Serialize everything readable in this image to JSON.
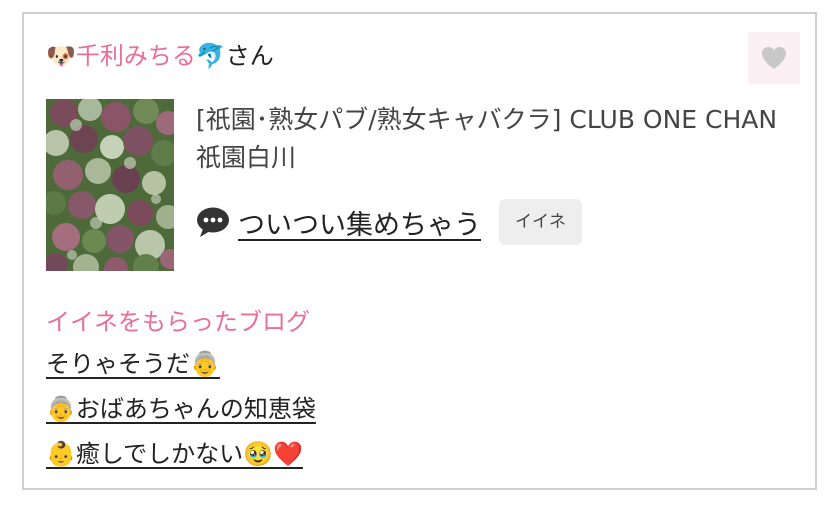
{
  "header": {
    "emoji_left": "🐶",
    "user_name": "千利みちる",
    "emoji_right": "🐬",
    "honorific": "さん"
  },
  "like_button": {
    "icon": "heart-icon",
    "color": "#c8c8c8"
  },
  "shop": {
    "category_name": "[祇園･熟女パブ/熟女キャバクラ]  CLUB ONE CHAN",
    "area": "祇園白川"
  },
  "post": {
    "icon": "speech-bubble-icon",
    "title": "ついつい集めちゃう",
    "iine_label": "イイネ"
  },
  "liked_blogs": {
    "heading": "イイネをもらったブログ",
    "items": [
      "そりゃそうだ👵",
      "👵おばあちゃんの知恵袋",
      "👶癒しでしかない🥹❤️"
    ]
  },
  "colors": {
    "accent_pink": "#e86f98",
    "card_border": "#cfcfcf",
    "badge_bg": "#eeeeee"
  }
}
